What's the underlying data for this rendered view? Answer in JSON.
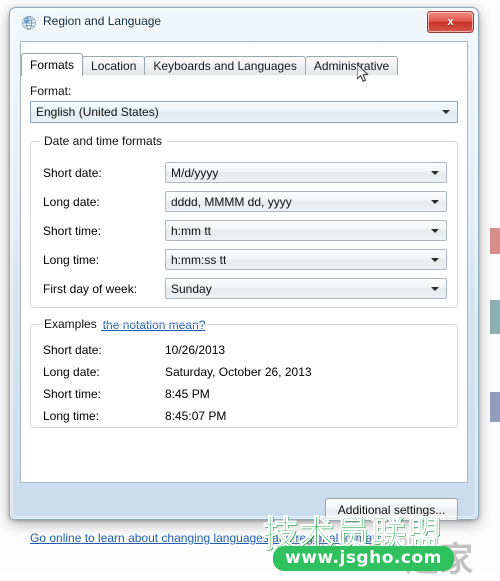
{
  "window": {
    "title": "Region and Language",
    "icon": "globe-icon",
    "close_label": "x"
  },
  "tabs": [
    {
      "label": "Formats",
      "active": true
    },
    {
      "label": "Location",
      "active": false
    },
    {
      "label": "Keyboards and Languages",
      "active": false
    },
    {
      "label": "Administrative",
      "active": false
    }
  ],
  "format": {
    "label": "Format:",
    "value": "English (United States)"
  },
  "date_time_group": {
    "title": "Date and time formats",
    "rows": [
      {
        "label": "Short date:",
        "value": "M/d/yyyy"
      },
      {
        "label": "Long date:",
        "value": "dddd, MMMM dd, yyyy"
      },
      {
        "label": "Short time:",
        "value": "h:mm tt"
      },
      {
        "label": "Long time:",
        "value": "h:mm:ss tt"
      },
      {
        "label": "First day of week:",
        "value": "Sunday"
      }
    ],
    "notation_link": "What does the notation mean?"
  },
  "examples_group": {
    "title": "Examples",
    "rows": [
      {
        "label": "Short date:",
        "value": "10/26/2013"
      },
      {
        "label": "Long date:",
        "value": "Saturday, October 26, 2013"
      },
      {
        "label": "Short time:",
        "value": "8:45 PM"
      },
      {
        "label": "Long time:",
        "value": "8:45:07 PM"
      }
    ]
  },
  "footer": {
    "additional_settings": "Additional settings...",
    "online_link": "Go online to learn about changing languages and regional formats"
  },
  "watermark": {
    "brand": "技术员联盟",
    "url": "www.jsgho.com",
    "ghost": "之家",
    "ghost_small": "www.jsgho.com"
  },
  "colors": {
    "title_text": "#0c2b45",
    "link": "#1f5fb0",
    "close_red": "#c62f24",
    "watermark_green": "#2fc15e"
  }
}
